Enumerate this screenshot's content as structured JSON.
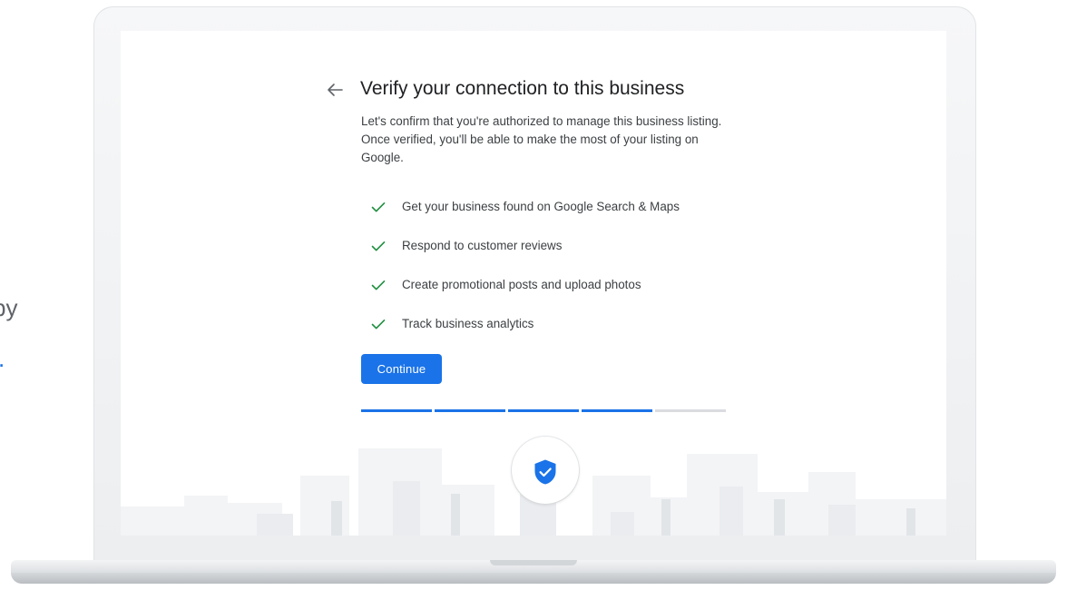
{
  "side": {
    "partial_text": "by",
    "partial_link": "."
  },
  "dialog": {
    "back_icon": "arrow-back-icon",
    "title": "Verify your connection to this business",
    "description": "Let's confirm that you're authorized to manage this business listing. Once verified, you'll be able to make the most of your listing on Google.",
    "benefits": [
      "Get your business found on Google Search & Maps",
      "Respond to customer reviews",
      "Create promotional posts and upload photos",
      "Track business analytics"
    ],
    "benefit_icon": "check-icon",
    "continue_label": "Continue",
    "progress": {
      "completed_steps": 4,
      "total_steps": 5
    },
    "badge_icon": "verified-shield-icon"
  },
  "colors": {
    "accent": "#1a73e8",
    "check": "#1e8e3e",
    "title_text": "#202124",
    "body_text": "#3c4043",
    "progress_track": "#dadce0"
  }
}
